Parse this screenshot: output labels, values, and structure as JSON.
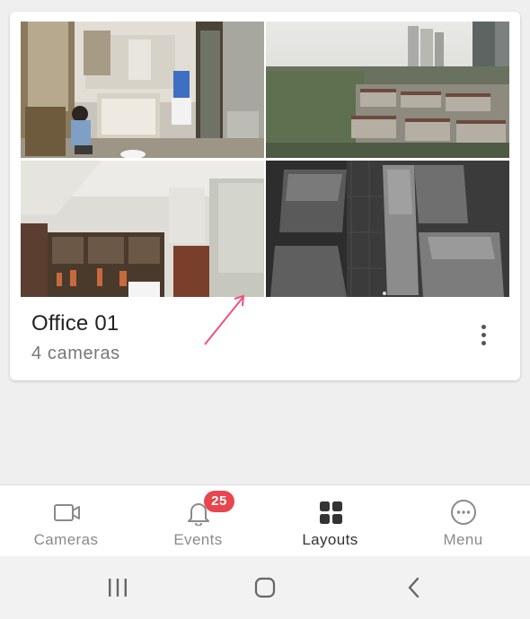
{
  "layout_card": {
    "name": "Office 01",
    "subtitle": "4 cameras"
  },
  "cameras": [
    {
      "id": "cam-1",
      "scene": "indoor-room"
    },
    {
      "id": "cam-2",
      "scene": "city-view"
    },
    {
      "id": "cam-3",
      "scene": "kitchen"
    },
    {
      "id": "cam-4",
      "scene": "night-vision-room"
    }
  ],
  "bottom_nav": {
    "items": [
      {
        "label": "Cameras",
        "icon": "video-camera-icon",
        "active": false
      },
      {
        "label": "Events",
        "icon": "bell-icon",
        "active": false,
        "badge": "25"
      },
      {
        "label": "Layouts",
        "icon": "grid-icon",
        "active": true
      },
      {
        "label": "Menu",
        "icon": "more-circle-icon",
        "active": false
      }
    ]
  },
  "colors": {
    "accent_badge": "#e8464f",
    "pointer_arrow": "#f0507a",
    "active_icon": "#333333",
    "inactive_icon": "#8a8a8a"
  },
  "system_nav": {
    "buttons": [
      "recent-apps",
      "home",
      "back"
    ]
  }
}
